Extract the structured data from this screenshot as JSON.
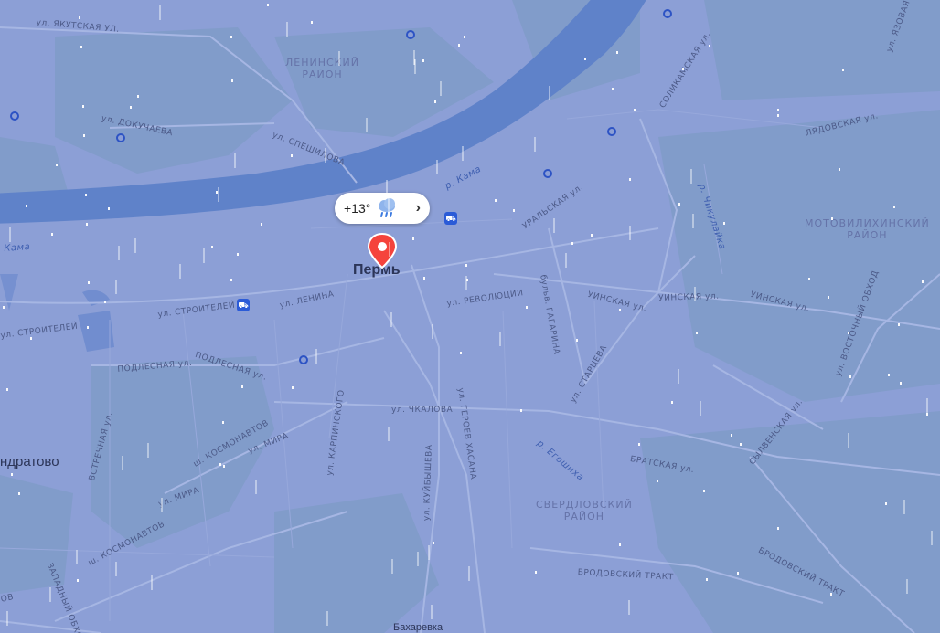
{
  "map": {
    "city_name": "Пермь",
    "weather": {
      "temperature": "+13°",
      "condition_icon": "rain-cloud-icon",
      "chevron": "›"
    },
    "labels": {
      "yakutskaya": "ул. ЯКУТСКАЯ УЛ.",
      "dokuchaeva": "ул. ДОКУЧАЕВА",
      "speshilova": "ул. СПЕШИЛОВА",
      "leninsky": "ЛЕНИНСКИЙ\nРАЙОН",
      "kama_river_1": "р. Кама",
      "kama_river_2": "Кама",
      "solikamskaya": "СОЛИКАМСКАЯ ул.",
      "lyadovskaya": "ЛЯДОВСКАЯ ул.",
      "yazovaya": "ул. ЯЗОВАЯ",
      "uralskaya": "УРАЛЬСКАЯ ул.",
      "chikulayka": "р. Чикулайка",
      "motovilikhinsky": "МОТОВИЛИХИНСКИЙ\nРАЙОН",
      "stroiteley_1": "ул. СТРОИТЕЛЕЙ",
      "stroiteley_2": "ул. СТРОИТЕЛЕЙ",
      "lenina": "ул. ЛЕНИНА",
      "revolyutsii": "ул. РЕВОЛЮЦИИ",
      "gagarina": "бульв. ГАГАРИНА",
      "uinskaya_1": "УИНСКАЯ ул.",
      "uinskaya_2": "УИНСКАЯ ул.",
      "uinskaya_3": "УИНСКАЯ ул.",
      "vostochny": "ул. ВОСТОЧНЫЙ ОБХОД",
      "podlesnaya_1": "ПОДЛЕСНАЯ ул.",
      "podlesnaya_2": "ПОДЛЕСНАЯ ул.",
      "karpinskogo": "ул. КАРПИНСКОГО",
      "chkalova": "ул. ЧКАЛОВА",
      "starceva": "ул. СТАРЦЕВА",
      "sylvenskaya": "СЫЛВЕНСКАЯ ул.",
      "kondratovo": "ндратово",
      "vstrechnaya": "ВСТРЕЧНАЯ ул.",
      "kosmonavtov_1": "ш. КОСМОНАВТОВ",
      "kosmonavtov_2": "ш. КОСМОНАВТОВ",
      "mira_1": "ул. МИРА",
      "mira_2": "ул. МИРА",
      "kuybysheva": "ул. КУЙБЫШЕВА",
      "geroev_khasana": "ул. ГЕРОЕВ ХАСАНА",
      "egoshikha": "р. Егошиха",
      "bratskaya": "БРАТСКАЯ ул.",
      "sverdlovsky": "СВЕРДЛОВСКИЙ\nРАЙОН",
      "brodovsky_1": "БРОДОВСКИЙ ТРАКТ",
      "brodovsky_2": "БРОДОВСКИЙ ТРАКТ",
      "zapadny": "ЗАПАДНЫЙ ОБХОД",
      "kosmonavtov_3": "ОВ",
      "bakharevka": "Бахаревка"
    }
  }
}
